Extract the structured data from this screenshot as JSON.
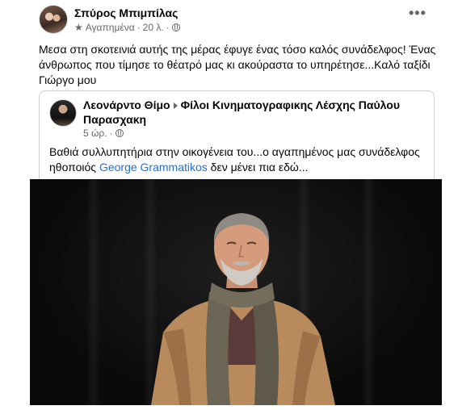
{
  "post": {
    "author": "Σπύρος Μπιμπίλας",
    "audience": "Αγαπημένα",
    "time": "20 λ.",
    "separator": "·",
    "more": "•••",
    "text": "Μεσα στη σκοτεινιά αυτής της μέρας έφυγε ένας τόσο καλός συνάδελφος! Ένας άνθρωπος που τίμησε το θέατρό μας  κι ακούραστα το υπηρέτησε...Καλό ταξίδι Γιώργο μου"
  },
  "shared_post": {
    "author": "Λεονάρντο Θίμο",
    "group": "Φίλοι Κινηματογραφικης Λέσχης Παύλου Παρασχακη",
    "time": "5 ώρ.",
    "separator": "·",
    "text_before": "Βαθιά συλλυπητήρια στην οικογένεια του...ο αγαπημένος μας συνάδελφος ηθοποιός ",
    "mention": "George Grammatikos",
    "text_after": " δεν μένει πια εδώ..."
  },
  "colors": {
    "text": "#050505",
    "secondary": "#65676b",
    "link": "#216fdb",
    "border": "#ced0d4"
  },
  "icons": [
    "star-icon",
    "globe-icon",
    "more-icon",
    "chevron-right-icon"
  ]
}
